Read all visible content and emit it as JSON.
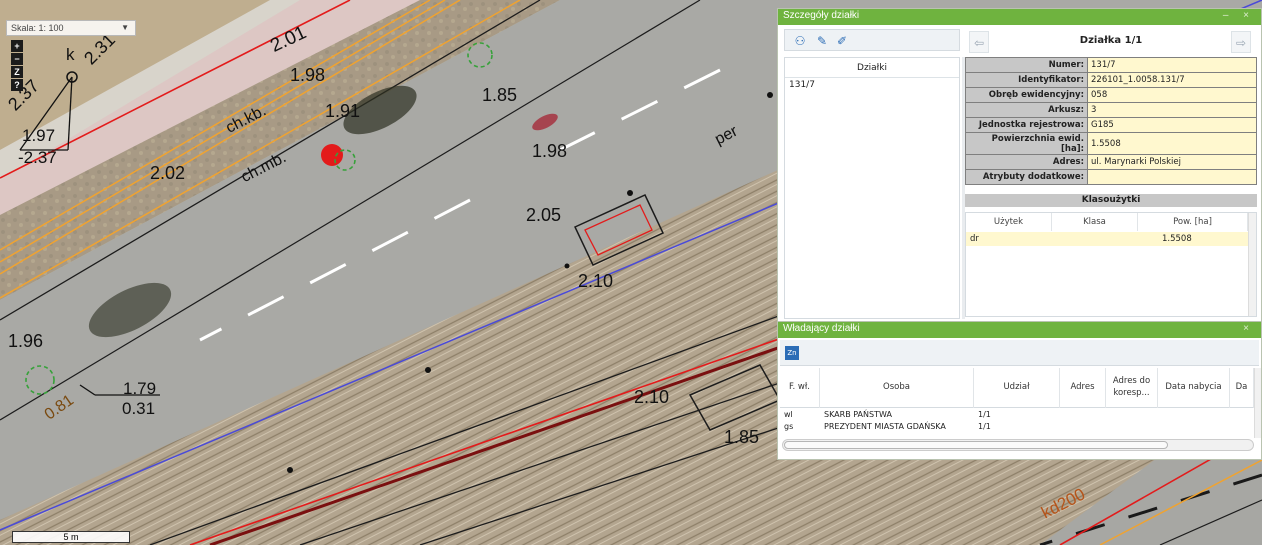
{
  "map": {
    "scale_label": "Skala: 1: 100",
    "zoom_in": "+",
    "zoom_out": "−",
    "zoom_z": "Z",
    "zoom_help": "?",
    "scalebar": "5 m",
    "labels": {
      "l201": "2.01",
      "l198a": "1.98",
      "l191": "1.91",
      "l185a": "1.85",
      "l198b": "1.98",
      "l237a": "2.37",
      "k": "k",
      "l231": "2.31",
      "l197": "1.97",
      "l237b": "-2.37",
      "chkb": "ch.kb.",
      "chmb": "ch.mb.",
      "l202": "2.02",
      "l205": "2.05",
      "l210a": "2.10",
      "per": "per",
      "l196": "1.96",
      "l179": "1.79",
      "l031": "0.31",
      "l081": "0.81",
      "l210b": "2.10",
      "l185b": "1.85",
      "kd200": "kd200"
    }
  },
  "details": {
    "title": "Szczegóły działki",
    "parcels_header": "Działki",
    "parcels": [
      "131/7"
    ],
    "nav_title": "Działka 1/1",
    "attributes": [
      {
        "key": "Numer:",
        "value": "131/7"
      },
      {
        "key": "Identyfikator:",
        "value": "226101_1.0058.131/7"
      },
      {
        "key": "Obręb ewidencyjny:",
        "value": "058"
      },
      {
        "key": "Arkusz:",
        "value": "3"
      },
      {
        "key": "Jednostka rejestrowa:",
        "value": "G185"
      },
      {
        "key": "Powierzchnia ewid. [ha]:",
        "value": "1.5508"
      },
      {
        "key": "Adres:",
        "value": "ul. Marynarki Polskiej"
      },
      {
        "key": "Atrybuty dodatkowe:",
        "value": ""
      }
    ],
    "klasouzytki_title": "Klasoużytki",
    "klas_columns": [
      "Użytek",
      "Klasa",
      "Pow. [ha]"
    ],
    "klas_rows": [
      {
        "uzytek": "dr",
        "klasa": "",
        "pow": "1.5508"
      }
    ]
  },
  "owners": {
    "title": "Władający działki",
    "zn_icon": "Zn",
    "columns": [
      "F. wł.",
      "Osoba",
      "Udział",
      "Adres",
      "Adres do koresp...",
      "Data nabycia",
      "Da"
    ],
    "rows": [
      {
        "fwl": "wl",
        "osoba": "SKARB PAŃSTWA",
        "udzial": "1/1"
      },
      {
        "fwl": "gs",
        "osoba": "PREZYDENT MIASTA GDAŃSKA",
        "udzial": "1/1"
      }
    ]
  },
  "colors": {
    "panel_title": "#6fb33f",
    "attr_key_bg": "#c7c7c7",
    "attr_value_bg": "#fff8cf",
    "map_red_line": "#e31b1b",
    "map_orange_line": "#f0a330",
    "map_blue_line": "#4a4ad8"
  }
}
